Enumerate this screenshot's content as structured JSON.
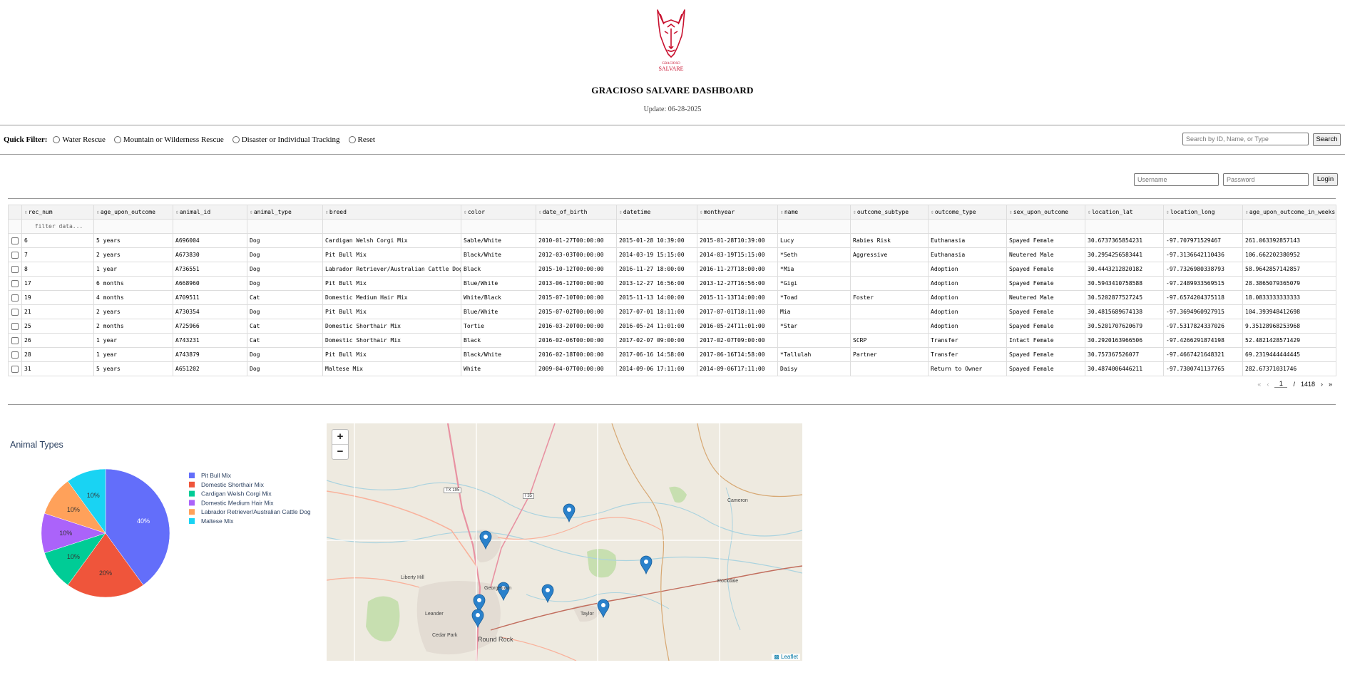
{
  "header": {
    "logo_text_top": "GRACIOSO",
    "logo_text_bottom": "SALVARE",
    "title": "GRACIOSO SALVARE DASHBOARD",
    "update": "Update: 06-28-2025"
  },
  "quick_filter": {
    "label": "Quick Filter:",
    "options": [
      "Water Rescue",
      "Mountain or Wilderness Rescue",
      "Disaster or Individual Tracking",
      "Reset"
    ]
  },
  "search": {
    "placeholder": "Search by ID, Name, or Type",
    "button": "Search"
  },
  "login": {
    "username_placeholder": "Username",
    "password_placeholder": "Password",
    "button": "Login"
  },
  "table": {
    "columns": [
      "rec_num",
      "age_upon_outcome",
      "animal_id",
      "animal_type",
      "breed",
      "color",
      "date_of_birth",
      "datetime",
      "monthyear",
      "name",
      "outcome_subtype",
      "outcome_type",
      "sex_upon_outcome",
      "location_lat",
      "location_long",
      "age_upon_outcome_in_weeks"
    ],
    "filter_placeholder": "filter data...",
    "rows": [
      [
        "6",
        "5 years",
        "A696004",
        "Dog",
        "Cardigan Welsh Corgi Mix",
        "Sable/White",
        "2010-01-27T00:00:00",
        "2015-01-28 10:39:00",
        "2015-01-28T10:39:00",
        "Lucy",
        "Rabies Risk",
        "Euthanasia",
        "Spayed Female",
        "30.6737365854231",
        "-97.707971529467",
        "261.063392857143"
      ],
      [
        "7",
        "2 years",
        "A673830",
        "Dog",
        "Pit Bull Mix",
        "Black/White",
        "2012-03-03T00:00:00",
        "2014-03-19 15:15:00",
        "2014-03-19T15:15:00",
        "*Seth",
        "Aggressive",
        "Euthanasia",
        "Neutered Male",
        "30.2954256583441",
        "-97.3136642110436",
        "106.662202380952"
      ],
      [
        "8",
        "1 year",
        "A736551",
        "Dog",
        "Labrador Retriever/Australian Cattle Dog",
        "Black",
        "2015-10-12T00:00:00",
        "2016-11-27 18:00:00",
        "2016-11-27T18:00:00",
        "*Mia",
        "",
        "Adoption",
        "Spayed Female",
        "30.4443212820182",
        "-97.7326980338793",
        "58.9642857142857"
      ],
      [
        "17",
        "6 months",
        "A668960",
        "Dog",
        "Pit Bull Mix",
        "Blue/White",
        "2013-06-12T00:00:00",
        "2013-12-27 16:56:00",
        "2013-12-27T16:56:00",
        "*Gigi",
        "",
        "Adoption",
        "Spayed Female",
        "30.5943410758588",
        "-97.2489933569515",
        "28.3865079365079"
      ],
      [
        "19",
        "4 months",
        "A709511",
        "Cat",
        "Domestic Medium Hair Mix",
        "White/Black",
        "2015-07-10T00:00:00",
        "2015-11-13 14:00:00",
        "2015-11-13T14:00:00",
        "*Toad",
        "Foster",
        "Adoption",
        "Neutered Male",
        "30.5202877527245",
        "-97.6574204375118",
        "18.0833333333333"
      ],
      [
        "21",
        "2 years",
        "A730354",
        "Dog",
        "Pit Bull Mix",
        "Blue/White",
        "2015-07-02T00:00:00",
        "2017-07-01 18:11:00",
        "2017-07-01T18:11:00",
        "Mia",
        "",
        "Adoption",
        "Spayed Female",
        "30.4815689674138",
        "-97.3694960927915",
        "104.393948412698"
      ],
      [
        "25",
        "2 months",
        "A725966",
        "Cat",
        "Domestic Shorthair Mix",
        "Tortie",
        "2016-03-20T00:00:00",
        "2016-05-24 11:01:00",
        "2016-05-24T11:01:00",
        "*Star",
        "",
        "Adoption",
        "Spayed Female",
        "30.5201707620679",
        "-97.5317824337026",
        "9.35128968253968"
      ],
      [
        "26",
        "1 year",
        "A743231",
        "Cat",
        "Domestic Shorthair Mix",
        "Black",
        "2016-02-06T00:00:00",
        "2017-02-07 09:00:00",
        "2017-02-07T09:00:00",
        "",
        "SCRP",
        "Transfer",
        "Intact Female",
        "30.2920163966506",
        "-97.4266291874198",
        "52.4821428571429"
      ],
      [
        "28",
        "1 year",
        "A743879",
        "Dog",
        "Pit Bull Mix",
        "Black/White",
        "2016-02-18T00:00:00",
        "2017-06-16 14:58:00",
        "2017-06-16T14:58:00",
        "*Tallulah",
        "Partner",
        "Transfer",
        "Spayed Female",
        "30.757367526077",
        "-97.4667421648321",
        "69.2319444444445"
      ],
      [
        "31",
        "5 years",
        "A651202",
        "Dog",
        "Maltese Mix",
        "White",
        "2009-04-07T00:00:00",
        "2014-09-06 17:11:00",
        "2014-09-06T17:11:00",
        "Daisy",
        "",
        "Return to Owner",
        "Spayed Female",
        "30.4874006446211",
        "-97.7300741137765",
        "282.67371031746"
      ]
    ]
  },
  "pagination": {
    "current": "1",
    "separator": "/",
    "total": "1418",
    "first": "«",
    "prev": "‹",
    "next": "›",
    "last": "»"
  },
  "chart_data": {
    "type": "pie",
    "title": "Animal Types",
    "labels": [
      "Pit Bull Mix",
      "Domestic Shorthair Mix",
      "Cardigan Welsh Corgi Mix",
      "Domestic Medium Hair Mix",
      "Labrador Retriever/Australian Cattle Dog",
      "Maltese Mix"
    ],
    "values": [
      40,
      20,
      10,
      10,
      10,
      10
    ],
    "colors": [
      "#636efa",
      "#ef553b",
      "#00cc96",
      "#ab63fa",
      "#ffa15a",
      "#19d3f3"
    ],
    "legend": "right"
  },
  "map": {
    "zoom_in": "+",
    "zoom_out": "−",
    "attribution": "Leaflet",
    "labels": [
      "TX 195",
      "I 35",
      "Cameron",
      "Liberty Hill",
      "Georgetown",
      "Leander",
      "Taylor",
      "Round Rock",
      "Cedar Park",
      "Rockdale"
    ],
    "marker_count": 8
  }
}
